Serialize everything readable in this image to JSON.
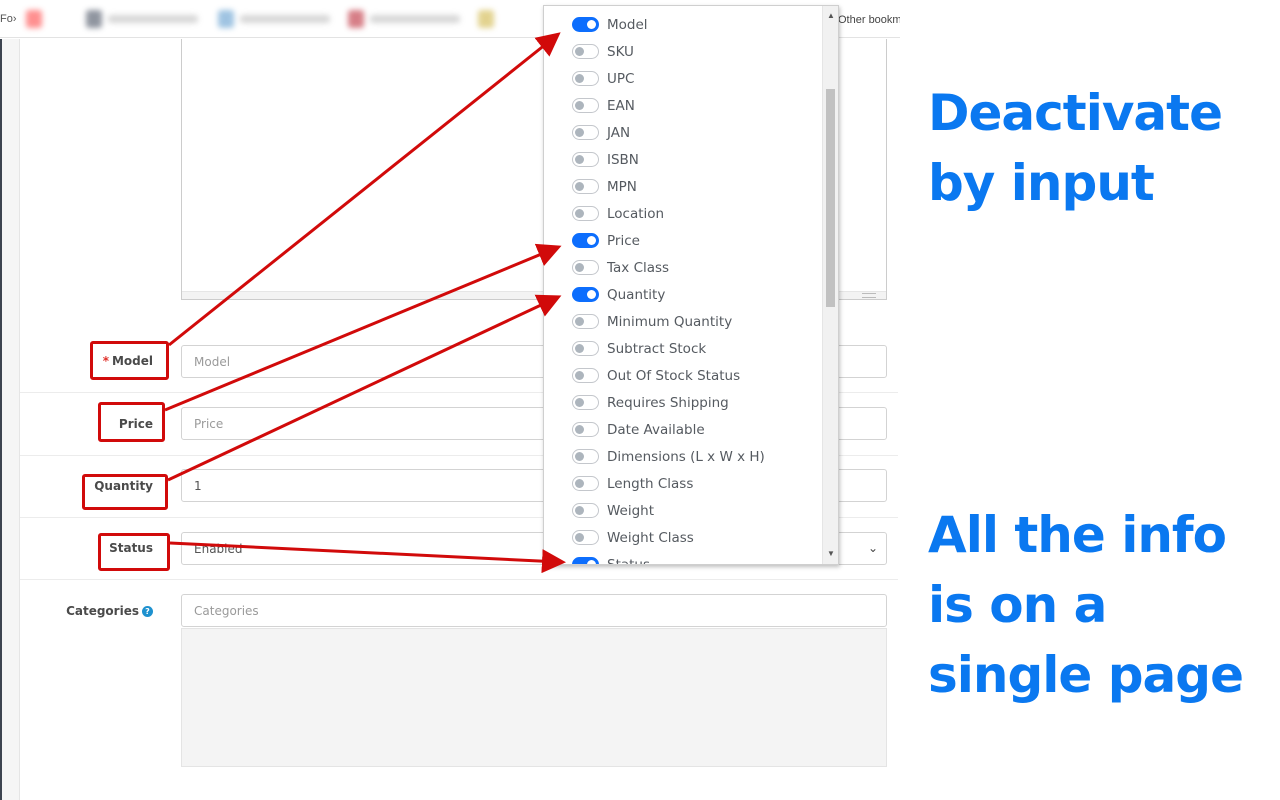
{
  "browser": {
    "bookmarks_edge_text": "Fo›",
    "other_bookmarks_label": "Other bookm"
  },
  "form": {
    "fields": [
      {
        "label": "Model",
        "required": true,
        "value": "",
        "placeholder": "Model"
      },
      {
        "label": "Price",
        "required": false,
        "value": "",
        "placeholder": "Price"
      },
      {
        "label": "Quantity",
        "required": false,
        "value": "1",
        "placeholder": ""
      },
      {
        "label": "Status",
        "required": false,
        "value": "Enabled",
        "type": "select"
      },
      {
        "label": "Categories",
        "required": false,
        "value": "",
        "placeholder": "Categories",
        "help_icon": "question-circle-icon"
      }
    ],
    "required_marker": "*",
    "help_glyph": "?"
  },
  "column_toggles": {
    "items": [
      {
        "label": "Model",
        "enabled": true
      },
      {
        "label": "SKU",
        "enabled": false
      },
      {
        "label": "UPC",
        "enabled": false
      },
      {
        "label": "EAN",
        "enabled": false
      },
      {
        "label": "JAN",
        "enabled": false
      },
      {
        "label": "ISBN",
        "enabled": false
      },
      {
        "label": "MPN",
        "enabled": false
      },
      {
        "label": "Location",
        "enabled": false
      },
      {
        "label": "Price",
        "enabled": true
      },
      {
        "label": "Tax Class",
        "enabled": false
      },
      {
        "label": "Quantity",
        "enabled": true
      },
      {
        "label": "Minimum Quantity",
        "enabled": false
      },
      {
        "label": "Subtract Stock",
        "enabled": false
      },
      {
        "label": "Out Of Stock Status",
        "enabled": false
      },
      {
        "label": "Requires Shipping",
        "enabled": false
      },
      {
        "label": "Date Available",
        "enabled": false
      },
      {
        "label": "Dimensions (L x W x H)",
        "enabled": false
      },
      {
        "label": "Length Class",
        "enabled": false
      },
      {
        "label": "Weight",
        "enabled": false
      },
      {
        "label": "Weight Class",
        "enabled": false
      },
      {
        "label": "Status",
        "enabled": true
      }
    ],
    "scroll_up_glyph": "▲",
    "scroll_down_glyph": "▼"
  },
  "captions": {
    "top": [
      "Deactivate",
      "by input"
    ],
    "bottom": [
      "All the info",
      "is on a",
      "single page"
    ]
  },
  "colors": {
    "accent_blue": "#0a78f0",
    "toggle_on": "#0d6efd",
    "annotation_red": "#d10a0a",
    "required_red": "#e0312b",
    "help_blue": "#1e91cf"
  },
  "icons": {
    "select_chevron": "⌄"
  }
}
